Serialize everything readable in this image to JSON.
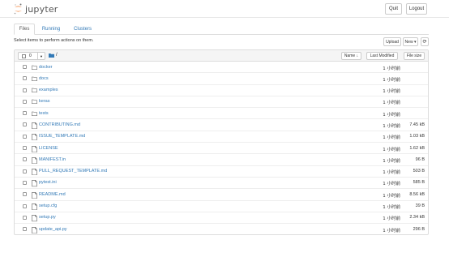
{
  "app": {
    "logo_text": "jupyter"
  },
  "header": {
    "quit_label": "Quit",
    "logout_label": "Logout"
  },
  "tabs": [
    {
      "label": "Files",
      "active": true
    },
    {
      "label": "Running",
      "active": false
    },
    {
      "label": "Clusters",
      "active": false
    }
  ],
  "toolbar": {
    "instruction": "Select items to perform actions on them.",
    "upload_label": "Upload",
    "new_label": "New ▾",
    "refresh_icon": "refresh-icon"
  },
  "list_header": {
    "selected_count": "0",
    "root_path": "/",
    "sort_name_label": "Name ↓",
    "sort_modified_label": "Last Modified",
    "sort_size_label": "File size"
  },
  "items": [
    {
      "name": "docker",
      "type": "folder",
      "modified": "1 小时前",
      "size": ""
    },
    {
      "name": "docs",
      "type": "folder",
      "modified": "1 小时前",
      "size": ""
    },
    {
      "name": "examples",
      "type": "folder",
      "modified": "1 小时前",
      "size": ""
    },
    {
      "name": "keras",
      "type": "folder",
      "modified": "1 小时前",
      "size": ""
    },
    {
      "name": "tests",
      "type": "folder",
      "modified": "1 小时前",
      "size": ""
    },
    {
      "name": "CONTRIBUTING.md",
      "type": "file",
      "modified": "1 小时前",
      "size": "7.45 kB"
    },
    {
      "name": "ISSUE_TEMPLATE.md",
      "type": "file",
      "modified": "1 小时前",
      "size": "1.03 kB"
    },
    {
      "name": "LICENSE",
      "type": "file",
      "modified": "1 小时前",
      "size": "1.62 kB"
    },
    {
      "name": "MANIFEST.in",
      "type": "file",
      "modified": "1 小时前",
      "size": "96 B"
    },
    {
      "name": "PULL_REQUEST_TEMPLATE.md",
      "type": "file",
      "modified": "1 小时前",
      "size": "503 B"
    },
    {
      "name": "pytest.ini",
      "type": "file",
      "modified": "1 小时前",
      "size": "585 B"
    },
    {
      "name": "README.md",
      "type": "file",
      "modified": "1 小时前",
      "size": "8.56 kB"
    },
    {
      "name": "setup.cfg",
      "type": "file",
      "modified": "1 小时前",
      "size": "39 B"
    },
    {
      "name": "setup.py",
      "type": "file",
      "modified": "1 小时前",
      "size": "2.34 kB"
    },
    {
      "name": "update_api.py",
      "type": "file",
      "modified": "1 小时前",
      "size": "296 B"
    }
  ],
  "colors": {
    "brand_orange": "#f37626",
    "link_blue": "#337ab7"
  }
}
